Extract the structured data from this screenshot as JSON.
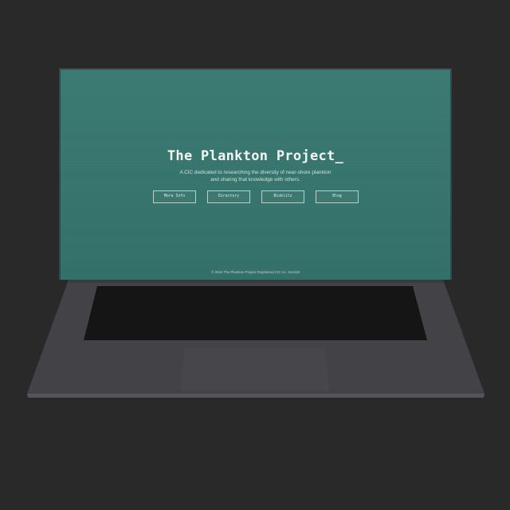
{
  "site": {
    "title": "The Plankton Project_",
    "tagline": [
      "A CIC dedicated to researching the diversity of near-shore plankton",
      "and sharing that knowledge with others."
    ],
    "nav": [
      {
        "label": "More Info"
      },
      {
        "label": "Directory"
      },
      {
        "label": "Bioblitz"
      },
      {
        "label": "Blog"
      }
    ],
    "footer": "© 2024 The Plankton Project Registered CIC no. 151418"
  },
  "colors": {
    "background": "#2a292a",
    "screen": "#36746d",
    "laptop_body": "#434247",
    "keyboard_well": "#141414",
    "text": "#f4f6f4"
  }
}
